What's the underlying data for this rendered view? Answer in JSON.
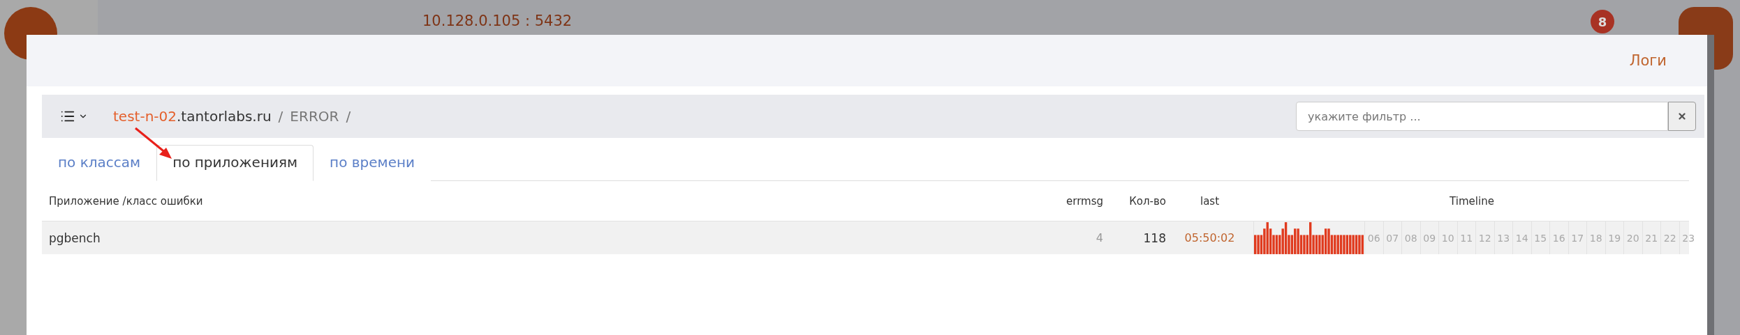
{
  "app_header": {
    "host": "10.128.0.105 : 5432",
    "notifications_badge": "8"
  },
  "modal": {
    "title": "Логи",
    "breadcrumb": {
      "host_highlight": "test-n-02",
      "host_rest": ".tantorlabs.ru",
      "separators": [
        "/",
        "/"
      ],
      "level": "ERROR"
    },
    "filter": {
      "placeholder": "укажите фильтр ..."
    },
    "tabs": [
      {
        "label": "по классам",
        "selected": false
      },
      {
        "label": "по приложениям",
        "selected": true
      },
      {
        "label": "по времени",
        "selected": false
      }
    ],
    "table": {
      "columns": [
        "Приложение /класс ошибки",
        "errmsg",
        "Кол-во",
        "last",
        "Timeline"
      ],
      "rows": [
        {
          "name": "pgbench",
          "errmsg": "4",
          "count": "118",
          "last": "05:50:02",
          "hour_labels": [
            "06",
            "07",
            "08",
            "09",
            "10",
            "11",
            "12",
            "13",
            "14",
            "15",
            "16",
            "17",
            "18",
            "19",
            "20",
            "21",
            "22",
            "23"
          ]
        }
      ]
    }
  }
}
